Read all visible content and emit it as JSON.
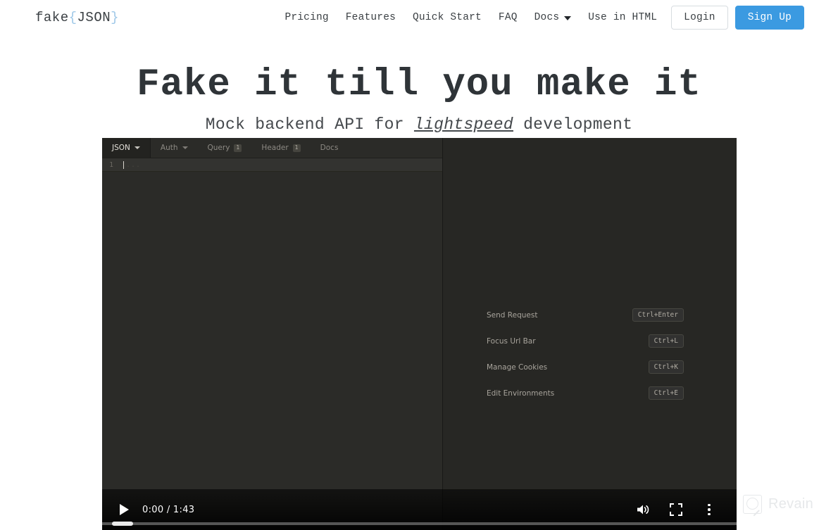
{
  "header": {
    "logo": {
      "prefix": "fake",
      "open_brace": "{",
      "json": "JSON",
      "close_brace": "}"
    },
    "nav": [
      {
        "label": "Pricing",
        "name": "nav-pricing",
        "caret": false
      },
      {
        "label": "Features",
        "name": "nav-features",
        "caret": false
      },
      {
        "label": "Quick Start",
        "name": "nav-quick-start",
        "caret": false
      },
      {
        "label": "FAQ",
        "name": "nav-faq",
        "caret": false
      },
      {
        "label": "Docs",
        "name": "nav-docs",
        "caret": true
      },
      {
        "label": "Use in HTML",
        "name": "nav-use-in-html",
        "caret": false
      }
    ],
    "login_label": "Login",
    "signup_label": "Sign Up",
    "accent_color": "#3b9ae1"
  },
  "hero": {
    "title": "Fake it till you make it",
    "subtitle_before": "Mock backend API for ",
    "subtitle_emphasis": "lightspeed",
    "subtitle_after": " development"
  },
  "video": {
    "app": {
      "tabs": [
        {
          "label": "JSON",
          "caret": true,
          "badge": null,
          "active": true
        },
        {
          "label": "Auth",
          "caret": true,
          "badge": null,
          "active": false
        },
        {
          "label": "Query",
          "caret": false,
          "badge": "1",
          "active": false
        },
        {
          "label": "Header",
          "caret": false,
          "badge": "1",
          "active": false
        },
        {
          "label": "Docs",
          "caret": false,
          "badge": null,
          "active": false
        }
      ],
      "editor": {
        "line_number": "1",
        "ghost_text": "..."
      },
      "shortcuts": [
        {
          "label": "Send Request",
          "key": "Ctrl+Enter"
        },
        {
          "label": "Focus Url Bar",
          "key": "Ctrl+L"
        },
        {
          "label": "Manage Cookies",
          "key": "Ctrl+K"
        },
        {
          "label": "Edit Environments",
          "key": "Ctrl+E"
        }
      ]
    },
    "controls": {
      "play_label": "Play",
      "time": "0:00 / 1:43",
      "current_time": "0:00",
      "duration": "1:43",
      "progress_percent": 0,
      "volume_label": "Mute",
      "fullscreen_label": "Full screen",
      "more_label": "More options"
    }
  },
  "watermark": {
    "text": "Revain"
  }
}
